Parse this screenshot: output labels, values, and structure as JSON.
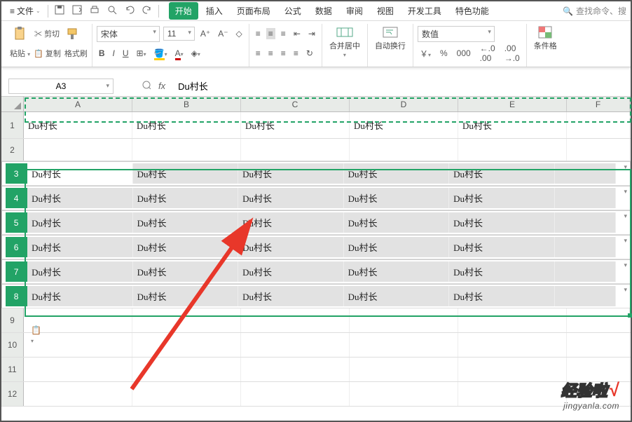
{
  "menu": {
    "file": "文件",
    "tabs": [
      "开始",
      "插入",
      "页面布局",
      "公式",
      "数据",
      "审阅",
      "视图",
      "开发工具",
      "特色功能"
    ],
    "active_tab_index": 0,
    "search_placeholder": "查找命令、搜"
  },
  "ribbon": {
    "paste": "粘贴",
    "cut": "剪切",
    "copy": "复制",
    "format_painter": "格式刷",
    "font_name": "宋体",
    "font_size": "11",
    "bold": "B",
    "italic": "I",
    "underline": "U",
    "a_plus": "A⁺",
    "a_minus": "A⁻",
    "merge_center": "合并居中",
    "auto_wrap": "自动换行",
    "number_format": "数值",
    "currency_sym": "￥",
    "percent": "%",
    "thousand": "000",
    "dec_inc": ".00",
    "dec_dec": ".0",
    "cond_format": "条件格"
  },
  "formula_bar": {
    "name_box": "A3",
    "fx_label": "fx",
    "value": "Du村长"
  },
  "columns": [
    "A",
    "B",
    "C",
    "D",
    "E",
    "F"
  ],
  "rows": [
    {
      "n": "1",
      "cells": [
        "Du村长",
        "Du村长",
        "Du村长",
        "Du村长",
        "Du村长",
        ""
      ]
    },
    {
      "n": "2",
      "cells": [
        "",
        "",
        "",
        "",
        "",
        ""
      ]
    },
    {
      "n": "3",
      "cells": [
        "Du村长",
        "Du村长",
        "Du村长",
        "Du村长",
        "Du村长",
        ""
      ]
    },
    {
      "n": "4",
      "cells": [
        "Du村长",
        "Du村长",
        "Du村长",
        "Du村长",
        "Du村长",
        ""
      ]
    },
    {
      "n": "5",
      "cells": [
        "Du村长",
        "Du村长",
        "Du村长",
        "Du村长",
        "Du村长",
        ""
      ]
    },
    {
      "n": "6",
      "cells": [
        "Du村长",
        "Du村长",
        "Du村长",
        "Du村长",
        "Du村长",
        ""
      ]
    },
    {
      "n": "7",
      "cells": [
        "Du村长",
        "Du村长",
        "Du村长",
        "Du村长",
        "Du村长",
        ""
      ]
    },
    {
      "n": "8",
      "cells": [
        "Du村长",
        "Du村长",
        "Du村长",
        "Du村长",
        "Du村长",
        ""
      ]
    },
    {
      "n": "9",
      "cells": [
        "",
        "",
        "",
        "",
        "",
        ""
      ]
    },
    {
      "n": "10",
      "cells": [
        "",
        "",
        "",
        "",
        "",
        ""
      ]
    },
    {
      "n": "11",
      "cells": [
        "",
        "",
        "",
        "",
        "",
        ""
      ]
    },
    {
      "n": "12",
      "cells": [
        "",
        "",
        "",
        "",
        "",
        ""
      ]
    }
  ],
  "watermark": {
    "line1": "经验啦",
    "check": "√",
    "line2": "jingyanla.com"
  },
  "icons": {
    "hamburger": "≡",
    "dropdown": "⌄",
    "save": "🖫",
    "undo": "↶",
    "redo": "↷",
    "print": "⎙",
    "preview": "👁",
    "search": "🔍"
  }
}
